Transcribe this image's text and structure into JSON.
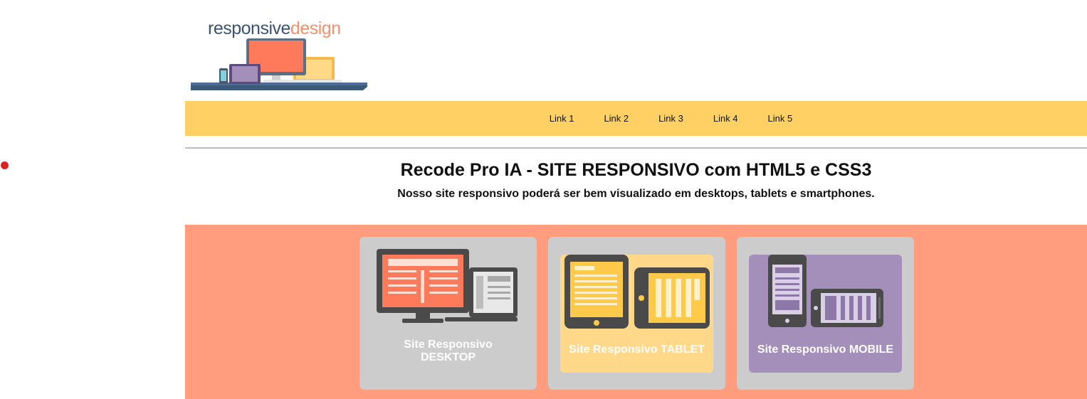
{
  "logo": {
    "word1": "responsive",
    "word2": "design",
    "illustration": "devices-illustration",
    "colors": {
      "word1": "#3a5470",
      "word2": "#f6916b"
    }
  },
  "nav": {
    "links": [
      "Link 1",
      "Link 2",
      "Link 3",
      "Link 4",
      "Link 5"
    ],
    "background": "#ffd064"
  },
  "header": {
    "title": "Recode Pro IA - SITE RESPONSIVO com HTML5 e CSS3",
    "subtitle": "Nosso site responsivo poderá ser bem visualizado em desktops, tablets e smartphones."
  },
  "cards": {
    "band_color": "#ff9d7e",
    "items": [
      {
        "label": "Site Responsivo DESKTOP",
        "icon": "desktop-icon",
        "color": "#cccccc"
      },
      {
        "label": "Site Responsivo TABLET",
        "icon": "tablet-icon",
        "color": "#ffd88a"
      },
      {
        "label": "Site Responsivo MOBILE",
        "icon": "mobile-icon",
        "color": "#a38fba"
      }
    ]
  }
}
